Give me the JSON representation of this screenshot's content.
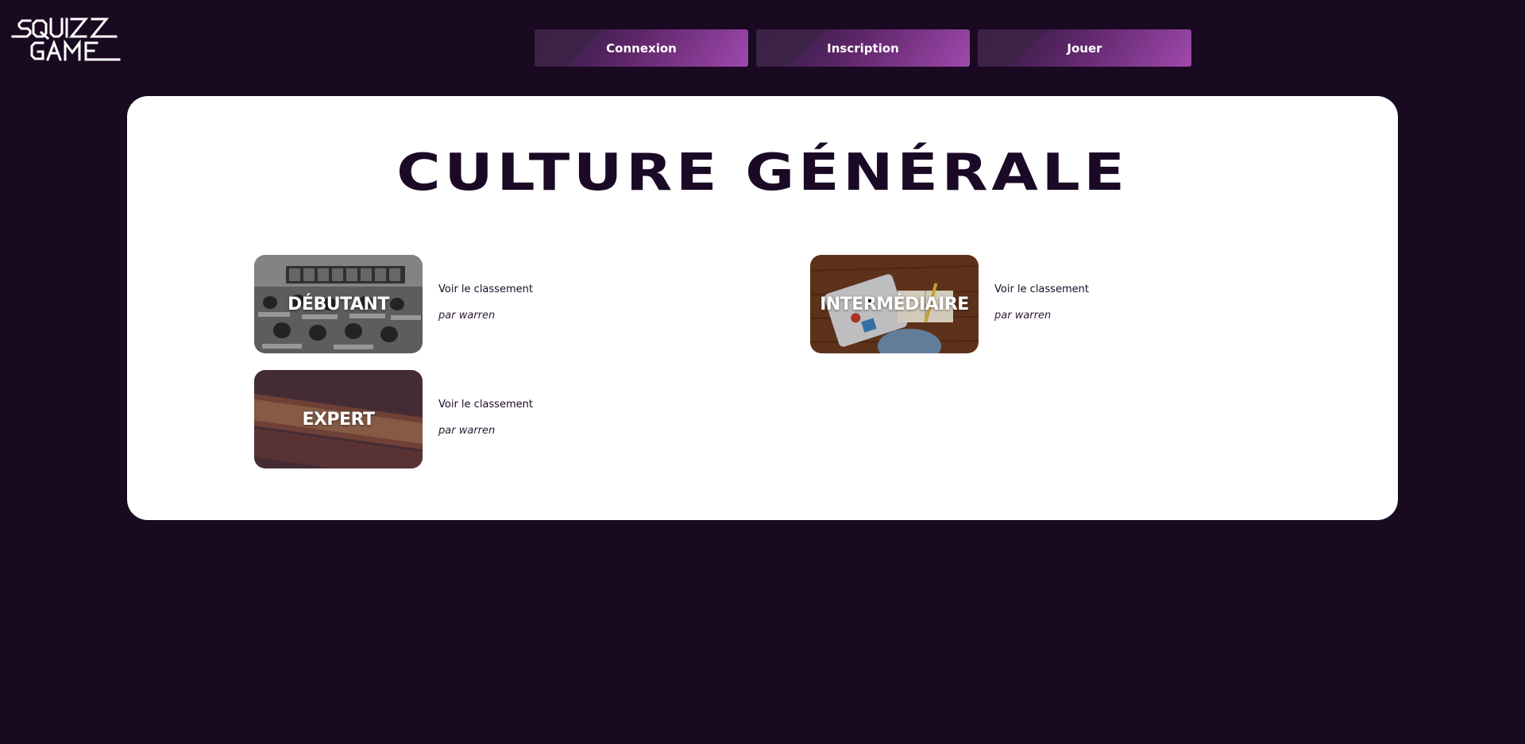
{
  "logo": {
    "line1": "SQUIZZ",
    "line2": "GAME"
  },
  "nav": [
    {
      "label": "Connexion"
    },
    {
      "label": "Inscription"
    },
    {
      "label": "Jouer"
    }
  ],
  "page": {
    "title": "CULTURE GÉNÉRALE"
  },
  "quizzes": [
    {
      "level": "DÉBUTANT",
      "leaderboard": "Voir le classement",
      "author": "par warren"
    },
    {
      "level": "INTERMÉDIAIRE",
      "leaderboard": "Voir le classement",
      "author": "par warren"
    },
    {
      "level": "EXPERT",
      "leaderboard": "Voir le classement",
      "author": "par warren"
    }
  ],
  "colors": {
    "background": "#190921",
    "accent": "#9f49ad",
    "card": "#ffffff",
    "title": "#1a0a26"
  }
}
